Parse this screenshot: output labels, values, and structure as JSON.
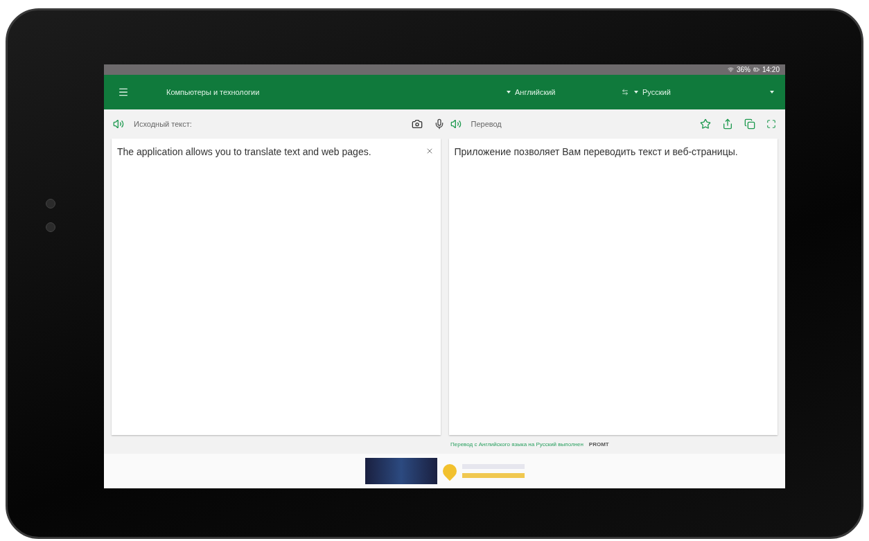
{
  "status_bar": {
    "battery": "36%",
    "time": "14:20"
  },
  "toolbar": {
    "topic": "Компьютеры и технологии",
    "source_language": "Английский",
    "target_language": "Русский"
  },
  "source_panel": {
    "label": "Исходный текст:",
    "text": "The application allows you to translate text and web pages."
  },
  "target_panel": {
    "label": "Перевод",
    "text": "Приложение позволяет Вам переводить текст и веб-страницы."
  },
  "credit": {
    "text": "Перевод с Английского языка на Русский выполнен",
    "brand": "PROMT"
  }
}
